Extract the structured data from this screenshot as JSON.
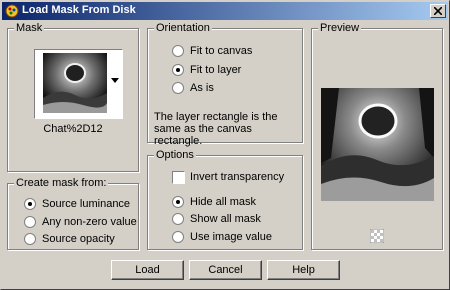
{
  "window": {
    "title": "Load Mask From Disk"
  },
  "mask": {
    "group_label": "Mask",
    "file_name": "Chat%2D12"
  },
  "create_mask_from": {
    "group_label": "Create mask from:",
    "options": [
      "Source luminance",
      "Any non-zero value",
      "Source opacity"
    ],
    "selected": "Source luminance"
  },
  "orientation": {
    "group_label": "Orientation",
    "options": [
      "Fit to canvas",
      "Fit to layer",
      "As is"
    ],
    "selected": "Fit to layer",
    "note": "The layer rectangle is the same as the canvas rectangle."
  },
  "options": {
    "group_label": "Options",
    "invert_transparency_label": "Invert transparency",
    "invert_transparency_checked": false,
    "mask_display": [
      "Hide all mask",
      "Show all mask",
      "Use image value"
    ],
    "selected": "Hide all mask"
  },
  "preview": {
    "group_label": "Preview"
  },
  "buttons": {
    "load": "Load",
    "cancel": "Cancel",
    "help": "Help"
  },
  "colors": {
    "titlebar_start": "#0a246a",
    "titlebar_end": "#a6caf0",
    "face": "#d4d0c8"
  }
}
